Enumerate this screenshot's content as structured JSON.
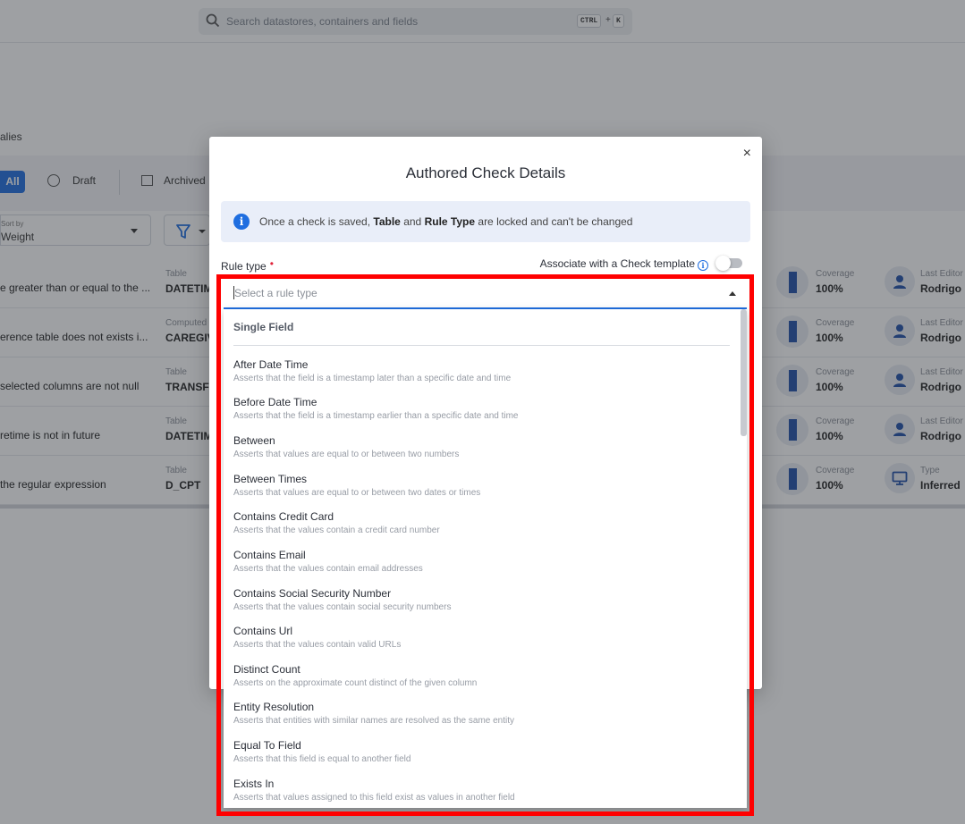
{
  "search": {
    "placeholder": "Search datastores, containers and fields",
    "shortcut_ctrl": "CTRL",
    "shortcut_plus": "+",
    "shortcut_key": "K"
  },
  "breadcrumb": "alies",
  "tabs": {
    "all": "All",
    "draft": "Draft",
    "archived": "Archived"
  },
  "sort": {
    "label": "Sort by",
    "value": "Weight"
  },
  "rows": [
    {
      "name": "e greater than or equal to the ...",
      "table_label": "Table",
      "table_value": "DATETIM",
      "cov_label": "Coverage",
      "cov_value": "100%",
      "ed_label": "Last Editor",
      "ed_value": "Rodrigo"
    },
    {
      "name": "erence table does not exists i...",
      "table_label": "Computed",
      "table_value": "CAREGIV",
      "cov_label": "Coverage",
      "cov_value": "100%",
      "ed_label": "Last Editor",
      "ed_value": "Rodrigo"
    },
    {
      "name": "selected columns are not null",
      "table_label": "Table",
      "table_value": "TRANSFE",
      "cov_label": "Coverage",
      "cov_value": "100%",
      "ed_label": "Last Editor",
      "ed_value": "Rodrigo"
    },
    {
      "name": "retime is not in future",
      "table_label": "Table",
      "table_value": "DATETIM",
      "cov_label": "Coverage",
      "cov_value": "100%",
      "ed_label": "Last Editor",
      "ed_value": "Rodrigo"
    },
    {
      "name": "the regular expression",
      "table_label": "Table",
      "table_value": "D_CPT",
      "cov_label": "Coverage",
      "cov_value": "100%",
      "ed_label": "Type",
      "ed_value": "Inferred"
    }
  ],
  "modal": {
    "title": "Authored Check Details",
    "close": "×",
    "info_prefix": "Once a check is saved,",
    "info_table": "Table",
    "info_and": "and",
    "info_ruletype": "Rule Type",
    "info_suffix": "are locked and can't be changed",
    "rule_type_label": "Rule type",
    "required_mark": "•",
    "associate_label": "Associate with a Check template",
    "select_placeholder": "Select a rule type"
  },
  "dropdown": {
    "group": "Single Field",
    "options": [
      {
        "title": "After Date Time",
        "desc": "Asserts that the field is a timestamp later than a specific date and time"
      },
      {
        "title": "Before Date Time",
        "desc": "Asserts that the field is a timestamp earlier than a specific date and time"
      },
      {
        "title": "Between",
        "desc": "Asserts that values are equal to or between two numbers"
      },
      {
        "title": "Between Times",
        "desc": "Asserts that values are equal to or between two dates or times"
      },
      {
        "title": "Contains Credit Card",
        "desc": "Asserts that the values contain a credit card number"
      },
      {
        "title": "Contains Email",
        "desc": "Asserts that the values contain email addresses"
      },
      {
        "title": "Contains Social Security Number",
        "desc": "Asserts that the values contain social security numbers"
      },
      {
        "title": "Contains Url",
        "desc": "Asserts that the values contain valid URLs"
      },
      {
        "title": "Distinct Count",
        "desc": "Asserts on the approximate count distinct of the given column"
      },
      {
        "title": "Entity Resolution",
        "desc": "Asserts that entities with similar names are resolved as the same entity"
      },
      {
        "title": "Equal To Field",
        "desc": "Asserts that this field is equal to another field"
      },
      {
        "title": "Exists In",
        "desc": "Asserts that values assigned to this field exist as values in another field"
      }
    ]
  },
  "colors": {
    "accent": "#1f6ee0",
    "highlight": "#ff0000",
    "required": "#e0233a"
  }
}
